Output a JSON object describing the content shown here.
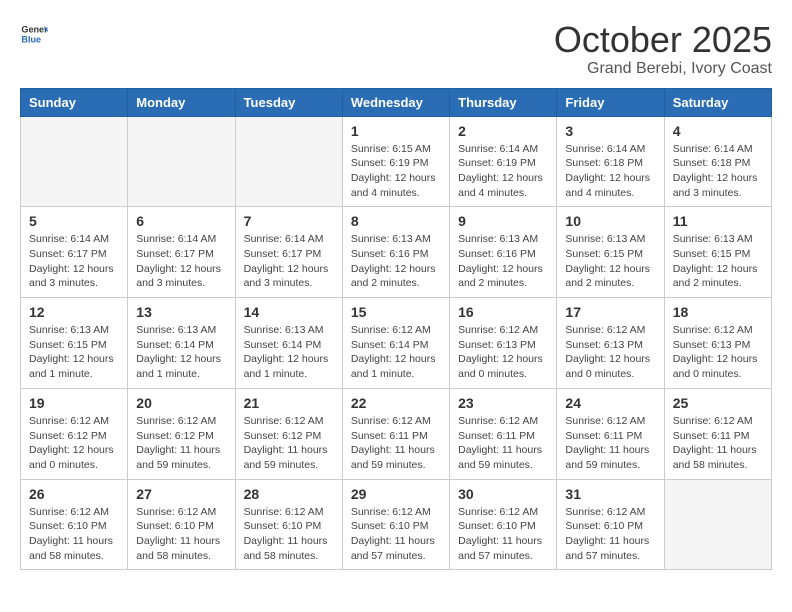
{
  "logo": {
    "general": "General",
    "blue": "Blue"
  },
  "title": "October 2025",
  "location": "Grand Berebi, Ivory Coast",
  "weekdays": [
    "Sunday",
    "Monday",
    "Tuesday",
    "Wednesday",
    "Thursday",
    "Friday",
    "Saturday"
  ],
  "weeks": [
    [
      {
        "day": "",
        "info": ""
      },
      {
        "day": "",
        "info": ""
      },
      {
        "day": "",
        "info": ""
      },
      {
        "day": "1",
        "info": "Sunrise: 6:15 AM\nSunset: 6:19 PM\nDaylight: 12 hours\nand 4 minutes."
      },
      {
        "day": "2",
        "info": "Sunrise: 6:14 AM\nSunset: 6:19 PM\nDaylight: 12 hours\nand 4 minutes."
      },
      {
        "day": "3",
        "info": "Sunrise: 6:14 AM\nSunset: 6:18 PM\nDaylight: 12 hours\nand 4 minutes."
      },
      {
        "day": "4",
        "info": "Sunrise: 6:14 AM\nSunset: 6:18 PM\nDaylight: 12 hours\nand 3 minutes."
      }
    ],
    [
      {
        "day": "5",
        "info": "Sunrise: 6:14 AM\nSunset: 6:17 PM\nDaylight: 12 hours\nand 3 minutes."
      },
      {
        "day": "6",
        "info": "Sunrise: 6:14 AM\nSunset: 6:17 PM\nDaylight: 12 hours\nand 3 minutes."
      },
      {
        "day": "7",
        "info": "Sunrise: 6:14 AM\nSunset: 6:17 PM\nDaylight: 12 hours\nand 3 minutes."
      },
      {
        "day": "8",
        "info": "Sunrise: 6:13 AM\nSunset: 6:16 PM\nDaylight: 12 hours\nand 2 minutes."
      },
      {
        "day": "9",
        "info": "Sunrise: 6:13 AM\nSunset: 6:16 PM\nDaylight: 12 hours\nand 2 minutes."
      },
      {
        "day": "10",
        "info": "Sunrise: 6:13 AM\nSunset: 6:15 PM\nDaylight: 12 hours\nand 2 minutes."
      },
      {
        "day": "11",
        "info": "Sunrise: 6:13 AM\nSunset: 6:15 PM\nDaylight: 12 hours\nand 2 minutes."
      }
    ],
    [
      {
        "day": "12",
        "info": "Sunrise: 6:13 AM\nSunset: 6:15 PM\nDaylight: 12 hours\nand 1 minute."
      },
      {
        "day": "13",
        "info": "Sunrise: 6:13 AM\nSunset: 6:14 PM\nDaylight: 12 hours\nand 1 minute."
      },
      {
        "day": "14",
        "info": "Sunrise: 6:13 AM\nSunset: 6:14 PM\nDaylight: 12 hours\nand 1 minute."
      },
      {
        "day": "15",
        "info": "Sunrise: 6:12 AM\nSunset: 6:14 PM\nDaylight: 12 hours\nand 1 minute."
      },
      {
        "day": "16",
        "info": "Sunrise: 6:12 AM\nSunset: 6:13 PM\nDaylight: 12 hours\nand 0 minutes."
      },
      {
        "day": "17",
        "info": "Sunrise: 6:12 AM\nSunset: 6:13 PM\nDaylight: 12 hours\nand 0 minutes."
      },
      {
        "day": "18",
        "info": "Sunrise: 6:12 AM\nSunset: 6:13 PM\nDaylight: 12 hours\nand 0 minutes."
      }
    ],
    [
      {
        "day": "19",
        "info": "Sunrise: 6:12 AM\nSunset: 6:12 PM\nDaylight: 12 hours\nand 0 minutes."
      },
      {
        "day": "20",
        "info": "Sunrise: 6:12 AM\nSunset: 6:12 PM\nDaylight: 11 hours\nand 59 minutes."
      },
      {
        "day": "21",
        "info": "Sunrise: 6:12 AM\nSunset: 6:12 PM\nDaylight: 11 hours\nand 59 minutes."
      },
      {
        "day": "22",
        "info": "Sunrise: 6:12 AM\nSunset: 6:11 PM\nDaylight: 11 hours\nand 59 minutes."
      },
      {
        "day": "23",
        "info": "Sunrise: 6:12 AM\nSunset: 6:11 PM\nDaylight: 11 hours\nand 59 minutes."
      },
      {
        "day": "24",
        "info": "Sunrise: 6:12 AM\nSunset: 6:11 PM\nDaylight: 11 hours\nand 59 minutes."
      },
      {
        "day": "25",
        "info": "Sunrise: 6:12 AM\nSunset: 6:11 PM\nDaylight: 11 hours\nand 58 minutes."
      }
    ],
    [
      {
        "day": "26",
        "info": "Sunrise: 6:12 AM\nSunset: 6:10 PM\nDaylight: 11 hours\nand 58 minutes."
      },
      {
        "day": "27",
        "info": "Sunrise: 6:12 AM\nSunset: 6:10 PM\nDaylight: 11 hours\nand 58 minutes."
      },
      {
        "day": "28",
        "info": "Sunrise: 6:12 AM\nSunset: 6:10 PM\nDaylight: 11 hours\nand 58 minutes."
      },
      {
        "day": "29",
        "info": "Sunrise: 6:12 AM\nSunset: 6:10 PM\nDaylight: 11 hours\nand 57 minutes."
      },
      {
        "day": "30",
        "info": "Sunrise: 6:12 AM\nSunset: 6:10 PM\nDaylight: 11 hours\nand 57 minutes."
      },
      {
        "day": "31",
        "info": "Sunrise: 6:12 AM\nSunset: 6:10 PM\nDaylight: 11 hours\nand 57 minutes."
      },
      {
        "day": "",
        "info": ""
      }
    ]
  ]
}
